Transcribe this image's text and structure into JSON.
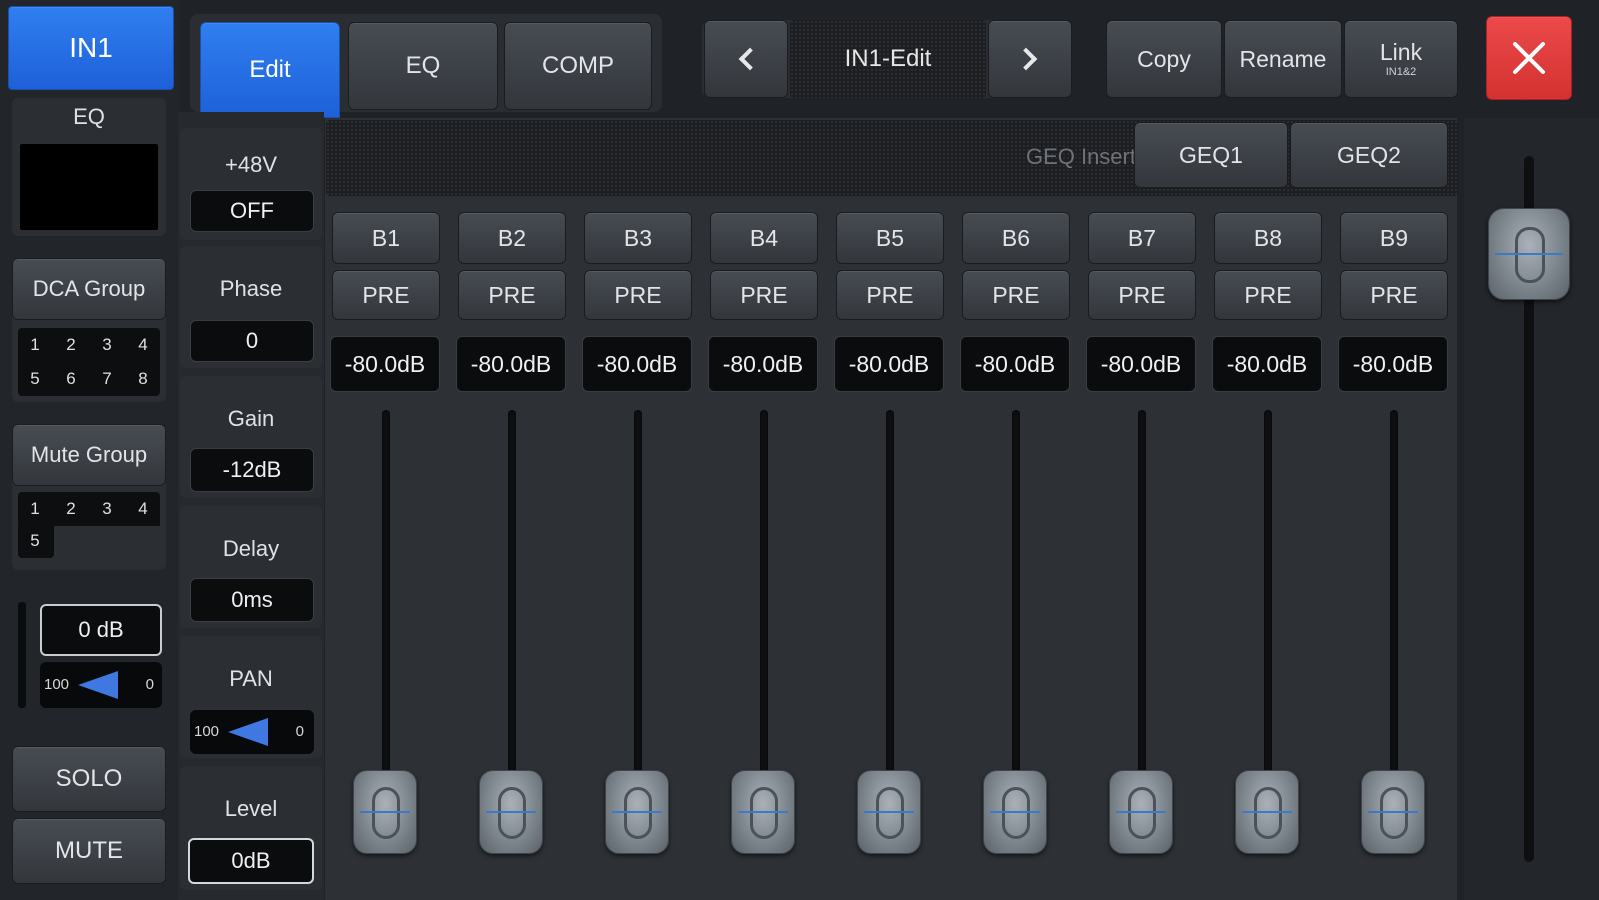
{
  "channel": {
    "name": "IN1"
  },
  "tabs": [
    {
      "label": "Edit",
      "active": true
    },
    {
      "label": "EQ",
      "active": false
    },
    {
      "label": "COMP",
      "active": false
    }
  ],
  "nav": {
    "title": "IN1-Edit"
  },
  "actions": {
    "copy": "Copy",
    "rename": "Rename",
    "link": "Link",
    "link_sub": "IN1&2"
  },
  "left": {
    "eq_label": "EQ",
    "dca_label": "DCA Group",
    "dca_numbers": [
      "1",
      "2",
      "3",
      "4",
      "5",
      "6",
      "7",
      "8"
    ],
    "mute_label": "Mute Group",
    "mute_numbers": [
      "1",
      "2",
      "3",
      "4",
      "5"
    ],
    "level_db": "0 dB",
    "pan_left": "100",
    "pan_right": "0",
    "solo": "SOLO",
    "mute": "MUTE"
  },
  "params": {
    "phantom": {
      "label": "+48V",
      "value": "OFF"
    },
    "phase": {
      "label": "Phase",
      "value": "0"
    },
    "gain": {
      "label": "Gain",
      "value": "-12dB"
    },
    "delay": {
      "label": "Delay",
      "value": "0ms"
    },
    "pan": {
      "label": "PAN",
      "left": "100",
      "right": "0"
    },
    "level": {
      "label": "Level",
      "value": "0dB"
    }
  },
  "geq": {
    "label": "GEQ Insert",
    "buttons": [
      "GEQ1",
      "GEQ2"
    ]
  },
  "buses": [
    {
      "name": "B1",
      "mode": "PRE",
      "level": "-80.0dB"
    },
    {
      "name": "B2",
      "mode": "PRE",
      "level": "-80.0dB"
    },
    {
      "name": "B3",
      "mode": "PRE",
      "level": "-80.0dB"
    },
    {
      "name": "B4",
      "mode": "PRE",
      "level": "-80.0dB"
    },
    {
      "name": "B5",
      "mode": "PRE",
      "level": "-80.0dB"
    },
    {
      "name": "B6",
      "mode": "PRE",
      "level": "-80.0dB"
    },
    {
      "name": "B7",
      "mode": "PRE",
      "level": "-80.0dB"
    },
    {
      "name": "B8",
      "mode": "PRE",
      "level": "-80.0dB"
    },
    {
      "name": "B9",
      "mode": "PRE",
      "level": "-80.0dB"
    }
  ],
  "icons": {
    "prev": "chevron-left-icon",
    "next": "chevron-right-icon",
    "close": "close-icon"
  },
  "colors": {
    "accent_blue": "#2a72e6",
    "close_red": "#e23b3b",
    "background": "#1f2226"
  }
}
